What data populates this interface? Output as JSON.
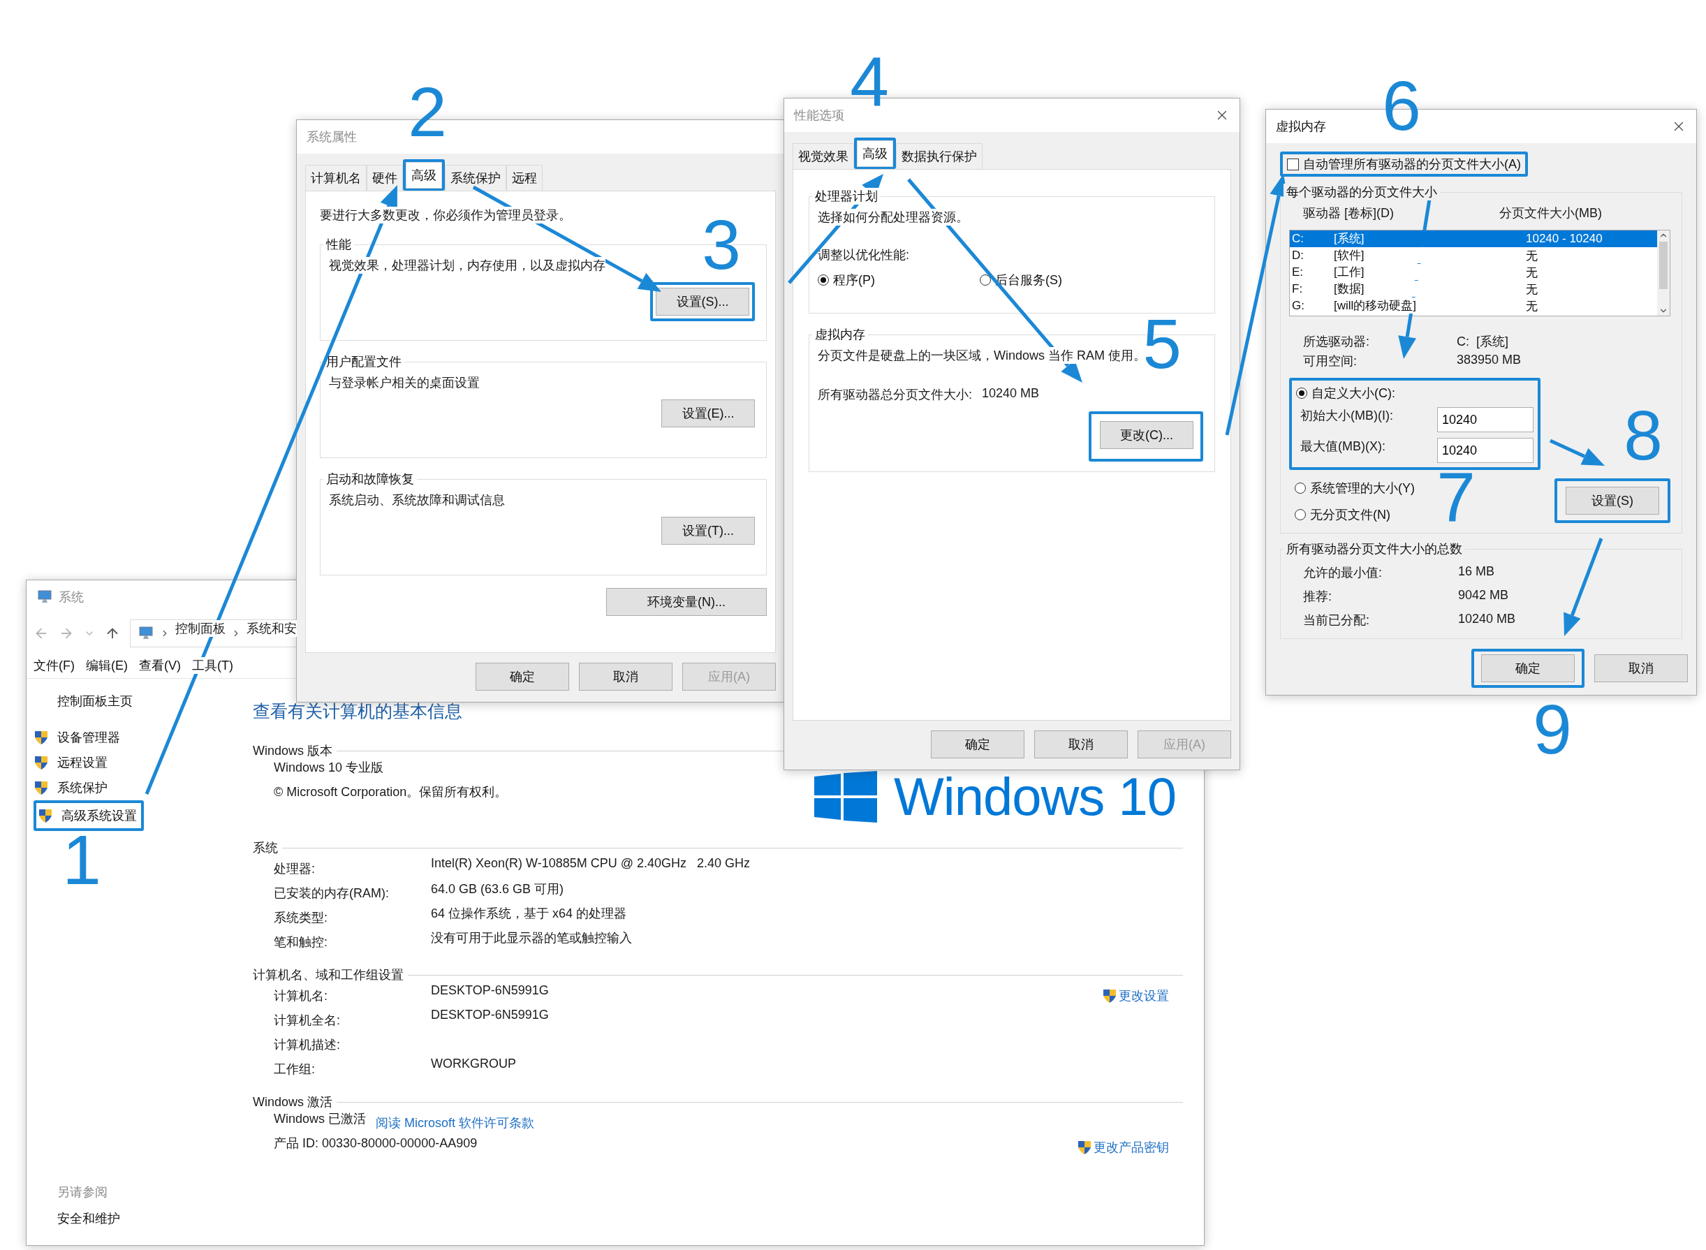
{
  "system_window": {
    "title": "系统",
    "active": false,
    "breadcrumb": [
      "控制面板",
      "系统和安"
    ],
    "menu": [
      "文件(F)",
      "编辑(E)",
      "查看(V)",
      "工具(T)"
    ],
    "sidebar": {
      "home": "控制面板主页",
      "links": [
        {
          "label": "设备管理器",
          "highlighted": false
        },
        {
          "label": "远程设置",
          "highlighted": false
        },
        {
          "label": "系统保护",
          "highlighted": false
        },
        {
          "label": "高级系统设置",
          "highlighted": true
        }
      ],
      "see_also_title": "另请参阅",
      "see_also": [
        "安全和维护"
      ]
    },
    "heading": "查看有关计算机的基本信息",
    "logo": "Windows 10",
    "sections": [
      {
        "title": "Windows 版本",
        "items": [
          {
            "kind": "line",
            "text": "Windows 10 专业版"
          },
          {
            "kind": "line",
            "text": "© Microsoft Corporation。保留所有权利。"
          }
        ]
      },
      {
        "title": "系统",
        "items": [
          {
            "kind": "row",
            "label": "处理器:",
            "value": "Intel(R) Xeon(R) W-10885M CPU @ 2.40GHz   2.40 GHz"
          },
          {
            "kind": "row",
            "label": "已安装的内存(RAM):",
            "value": "64.0 GB (63.6 GB 可用)"
          },
          {
            "kind": "row",
            "label": "系统类型:",
            "value": "64 位操作系统，基于 x64 的处理器"
          },
          {
            "kind": "row",
            "label": "笔和触控:",
            "value": "没有可用于此显示器的笔或触控输入"
          }
        ]
      },
      {
        "title": "计算机名、域和工作组设置",
        "items": [
          {
            "kind": "row",
            "label": "计算机名:",
            "value": "DESKTOP-6N5991G",
            "action": "更改设置"
          },
          {
            "kind": "row",
            "label": "计算机全名:",
            "value": "DESKTOP-6N5991G"
          },
          {
            "kind": "row",
            "label": "计算机描述:"
          },
          {
            "kind": "row",
            "label": "工作组:",
            "value": "WORKGROUP"
          }
        ]
      },
      {
        "title": "Windows 激活",
        "items": [
          {
            "kind": "line",
            "text": "Windows 已激活",
            "link": "阅读 Microsoft 软件许可条款"
          },
          {
            "kind": "line",
            "text": "产品 ID: 00330-80000-00000-AA909",
            "action": "更改产品密钥"
          }
        ]
      }
    ]
  },
  "system_properties": {
    "title": "系统属性",
    "active": false,
    "tabs": [
      {
        "label": "计算机名",
        "selected": false,
        "highlighted": false
      },
      {
        "label": "硬件",
        "selected": false,
        "highlighted": false
      },
      {
        "label": "高级",
        "selected": true,
        "highlighted": true
      },
      {
        "label": "系统保护",
        "selected": false,
        "highlighted": false
      },
      {
        "label": "远程",
        "selected": false,
        "highlighted": false
      }
    ],
    "notice": "要进行大多数更改，你必须作为管理员登录。",
    "groups": [
      {
        "title": "性能",
        "text": "视觉效果，处理器计划，内存使用，以及虚拟内存",
        "button": {
          "label": "设置(S)...",
          "highlighted": true
        }
      },
      {
        "title": "用户配置文件",
        "text": "与登录帐户相关的桌面设置",
        "button": {
          "label": "设置(E)...",
          "highlighted": false
        }
      },
      {
        "title": "启动和故障恢复",
        "text": "系统启动、系统故障和调试信息",
        "button": {
          "label": "设置(T)...",
          "highlighted": false
        }
      }
    ],
    "env_button": "环境变量(N)...",
    "buttons": [
      {
        "label": "确定",
        "disabled": false
      },
      {
        "label": "取消",
        "disabled": false
      },
      {
        "label": "应用(A)",
        "disabled": true
      }
    ]
  },
  "performance_options": {
    "title": "性能选项",
    "active": false,
    "tabs": [
      {
        "label": "视觉效果",
        "selected": false,
        "highlighted": false
      },
      {
        "label": "高级",
        "selected": true,
        "highlighted": true
      },
      {
        "label": "数据执行保护",
        "selected": false,
        "highlighted": false
      }
    ],
    "scheduling": {
      "title": "处理器计划",
      "text": "选择如何分配处理器资源。",
      "prompt": "调整以优化性能:",
      "options": [
        {
          "label": "程序(P)",
          "selected": true
        },
        {
          "label": "后台服务(S)",
          "selected": false
        }
      ]
    },
    "virtual_memory": {
      "title": "虚拟内存",
      "text": "分页文件是硬盘上的一块区域，Windows 当作 RAM 使用。",
      "total_label": "所有驱动器总分页文件大小:",
      "total_value": "10240 MB",
      "button": {
        "label": "更改(C)...",
        "highlighted": true
      }
    },
    "buttons": [
      {
        "label": "确定",
        "disabled": false
      },
      {
        "label": "取消",
        "disabled": false
      },
      {
        "label": "应用(A)",
        "disabled": true
      }
    ]
  },
  "virtual_memory": {
    "title": "虚拟内存",
    "active": true,
    "auto_manage": {
      "label": "自动管理所有驱动器的分页文件大小(A)",
      "checked": false,
      "highlighted": true
    },
    "per_drive": {
      "title": "每个驱动器的分页文件大小",
      "columns": [
        "驱动器 [卷标](D)",
        "分页文件大小(MB)"
      ],
      "drives": [
        {
          "letter": "C:",
          "label": "[系统]",
          "size": "10240 - 10240",
          "selected": true
        },
        {
          "letter": "D:",
          "label": "[软件]",
          "size": "无",
          "selected": false
        },
        {
          "letter": "E:",
          "label": "[工作]",
          "size": "无",
          "selected": false
        },
        {
          "letter": "F:",
          "label": "[数据]",
          "size": "无",
          "selected": false
        },
        {
          "letter": "G:",
          "label": "[will的移动硬盘]",
          "size": "无",
          "selected": false
        }
      ],
      "info": [
        {
          "label": "所选驱动器:",
          "value": "C:  [系统]"
        },
        {
          "label": "可用空间:",
          "value": "383950 MB"
        }
      ],
      "custom": {
        "label": "自定义大小(C):",
        "selected": true,
        "highlighted": true,
        "fields": [
          {
            "label": "初始大小(MB)(I):",
            "value": "10240"
          },
          {
            "label": "最大值(MB)(X):",
            "value": "10240"
          }
        ]
      },
      "other_options": [
        {
          "label": "系统管理的大小(Y)",
          "selected": false
        },
        {
          "label": "无分页文件(N)",
          "selected": false
        }
      ],
      "set_button": {
        "label": "设置(S)",
        "highlighted": true
      }
    },
    "totals": {
      "title": "所有驱动器分页文件大小的总数",
      "rows": [
        {
          "label": "允许的最小值:",
          "value": "16 MB"
        },
        {
          "label": "推荐:",
          "value": "9042 MB"
        },
        {
          "label": "当前已分配:",
          "value": "10240 MB"
        }
      ]
    },
    "buttons": [
      {
        "label": "确定",
        "highlighted": true
      },
      {
        "label": "取消",
        "highlighted": false
      }
    ]
  },
  "steps": [
    "1",
    "2",
    "3",
    "4",
    "5",
    "6",
    "7",
    "8",
    "9"
  ]
}
